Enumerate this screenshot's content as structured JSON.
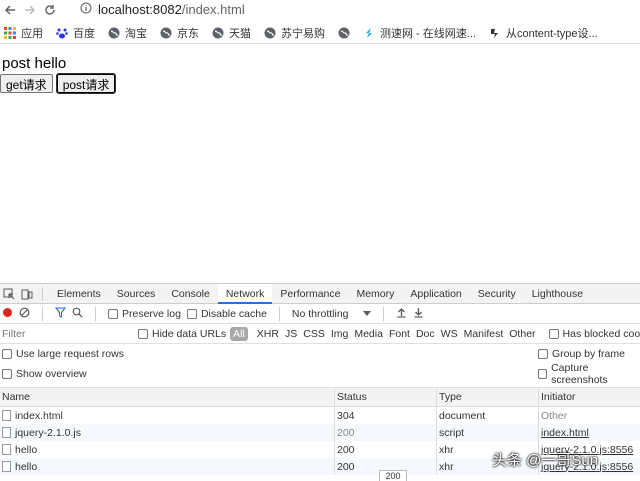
{
  "browser": {
    "url_host": "localhost:8082",
    "url_path": "/index.html",
    "bookmarks": [
      {
        "label": "应用",
        "icon": "apps-grid-icon"
      },
      {
        "label": "百度",
        "icon": "baidu-paw-icon"
      },
      {
        "label": "淘宝",
        "icon": "globe-icon"
      },
      {
        "label": "京东",
        "icon": "globe-icon"
      },
      {
        "label": "天猫",
        "icon": "globe-icon"
      },
      {
        "label": "苏宁易购",
        "icon": "globe-icon"
      },
      {
        "label": "",
        "icon": "globe-icon"
      },
      {
        "label": "测速网 - 在线网速...",
        "icon": "speedtest-icon"
      },
      {
        "label": "从content-type设...",
        "icon": "bookmark-logo-icon"
      }
    ]
  },
  "page": {
    "title": "post hello",
    "get_button": "get请求",
    "post_button": "post请求"
  },
  "devtools": {
    "tabs": [
      "Elements",
      "Sources",
      "Console",
      "Network",
      "Performance",
      "Memory",
      "Application",
      "Security",
      "Lighthouse"
    ],
    "active_tab": "Network",
    "toolbar": {
      "preserve_log": "Preserve log",
      "disable_cache": "Disable cache",
      "throttling": "No throttling"
    },
    "filter": {
      "placeholder": "Filter",
      "hide_data_urls": "Hide data URLs",
      "types": [
        "All",
        "XHR",
        "JS",
        "CSS",
        "Img",
        "Media",
        "Font",
        "Doc",
        "WS",
        "Manifest",
        "Other"
      ],
      "has_blocked_cookies": "Has blocked cookies"
    },
    "options": {
      "large_rows": "Use large request rows",
      "group_by_frame": "Group by frame",
      "show_overview": "Show overview",
      "capture_screenshots": "Capture screenshots"
    },
    "table": {
      "columns": [
        "Name",
        "Status",
        "Type",
        "Initiator"
      ],
      "rows": [
        {
          "name": "index.html",
          "status": "304",
          "type": "document",
          "initiator": "Other"
        },
        {
          "name": "jquery-2.1.0.js",
          "status": "200",
          "type": "script",
          "initiator": "index.html"
        },
        {
          "name": "hello",
          "status": "200",
          "type": "xhr",
          "initiator": "jquery-2.1.0.js:8556"
        },
        {
          "name": "hello",
          "status": "200",
          "type": "xhr",
          "initiator": "jquery-2.1.0.js:8556"
        }
      ]
    },
    "tooltip": "200"
  },
  "watermark": {
    "text": "头条 @一哥Sun"
  }
}
